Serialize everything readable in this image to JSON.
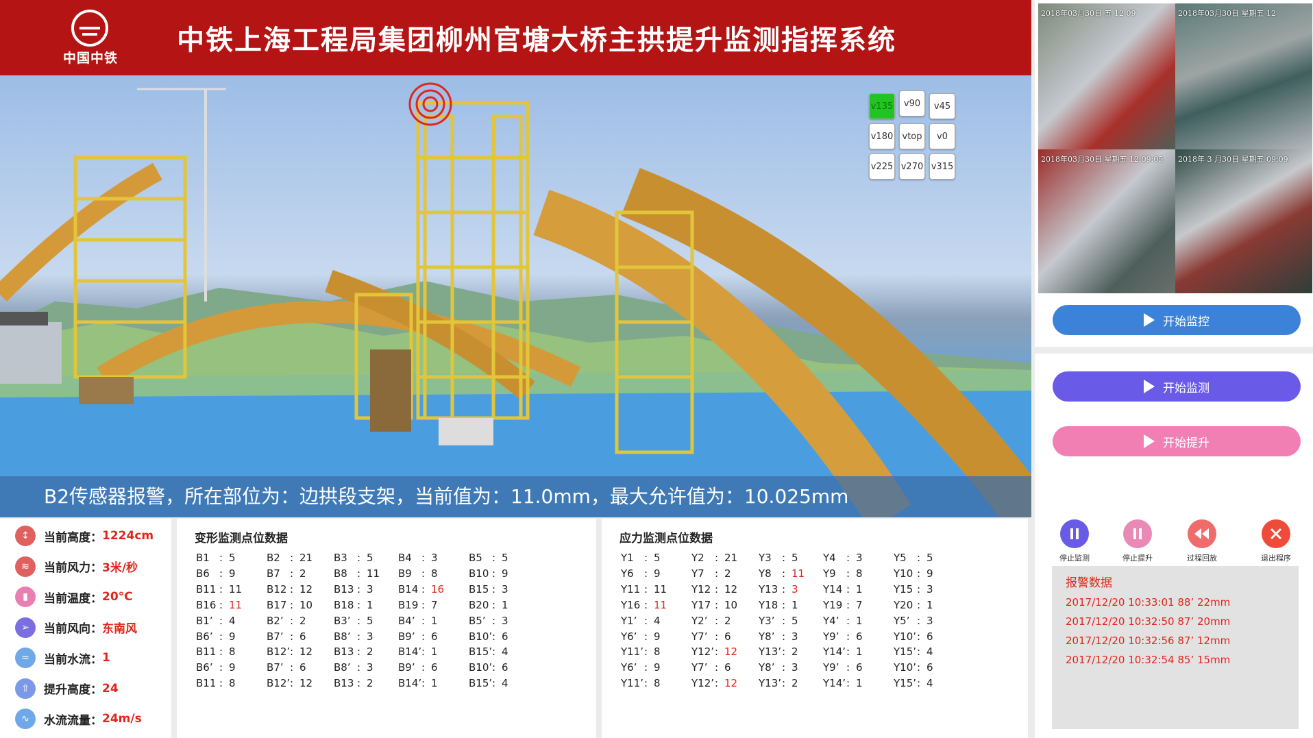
{
  "header": {
    "logo_text": "中国中铁",
    "title": "中铁上海工程局集团柳州官塘大桥主拱提升监测指挥系统"
  },
  "colors": {
    "header_red": "#b41414",
    "alert_red": "#e1251b",
    "active_green": "#22c422",
    "blue_btn": "#3b82d8",
    "purple_btn": "#6a5ae8",
    "pink_btn": "#f27fb4"
  },
  "view_buttons": [
    "v135",
    "v90",
    "v45",
    "v180",
    "vtop",
    "v0",
    "v225",
    "v270",
    "v315"
  ],
  "active_view": "v135",
  "alarm_message": "B2传感器报警，所在部位为：边拱段支架，当前值为：11.0mm，最大允许值为：10.025mm",
  "cameras": [
    {
      "timestamp": "2018年03月30日  五  12 09"
    },
    {
      "timestamp": "2018年03月30日  星期五 12"
    },
    {
      "timestamp": "2018年03月30日 星期五 12:09:05"
    },
    {
      "timestamp": "2018年 3 月30日 星期五 09:09"
    }
  ],
  "buttons": {
    "start_control": "开始监控",
    "start_monitor": "开始监测",
    "start_lift": "开始提升"
  },
  "controls": [
    {
      "label": "停止监测",
      "icon": "pause-icon"
    },
    {
      "label": "停止提升",
      "icon": "pause-icon"
    },
    {
      "label": "过程回放",
      "icon": "rewind-icon"
    },
    {
      "label": "退出程序",
      "icon": "close-icon"
    }
  ],
  "alarm_data": {
    "title": "报警数据",
    "rows": [
      "2017/12/20  10:33:01 88’   22mm",
      "2017/12/20  10:32:50 87’   20mm",
      "2017/12/20  10:32:56 87’   12mm",
      "2017/12/20  10:32:54 85’   15mm"
    ]
  },
  "status": [
    {
      "label": "当前高度：",
      "value": "1224cm",
      "icon": "height-icon",
      "color": "#e06060"
    },
    {
      "label": "当前风力：",
      "value": "3米/秒",
      "icon": "wind-icon",
      "color": "#e06060"
    },
    {
      "label": "当前温度：",
      "value": "20°C",
      "icon": "thermometer-icon",
      "color": "#e87fb0"
    },
    {
      "label": "当前风向：",
      "value": "东南风",
      "icon": "wind-direction-icon",
      "color": "#7a6ee0"
    },
    {
      "label": "当前水流：",
      "value": "1",
      "icon": "water-icon",
      "color": "#6fa8e8"
    },
    {
      "label": "提升高度：",
      "value": "24",
      "icon": "lift-icon",
      "color": "#7a9ae8"
    },
    {
      "label": "水流流量：",
      "value": "24m/s",
      "icon": "flow-icon",
      "color": "#6fa8e8"
    }
  ],
  "deform": {
    "title": "变形监测点位数据",
    "rows": [
      [
        [
          "B1",
          "5"
        ],
        [
          "B2",
          "21"
        ],
        [
          "B3",
          "5"
        ],
        [
          "B4",
          "3"
        ],
        [
          "B5",
          "5"
        ]
      ],
      [
        [
          "B6",
          "9"
        ],
        [
          "B7",
          "2"
        ],
        [
          "B8",
          "11"
        ],
        [
          "B9",
          "8"
        ],
        [
          "B10",
          "9"
        ]
      ],
      [
        [
          "B11",
          "11"
        ],
        [
          "B12",
          "12"
        ],
        [
          "B13",
          "3"
        ],
        [
          "B14",
          "16"
        ],
        [
          "B15",
          "3"
        ]
      ],
      [
        [
          "B16",
          "11"
        ],
        [
          "B17",
          "10"
        ],
        [
          "B18",
          "1"
        ],
        [
          "B19",
          "7"
        ],
        [
          "B20",
          "1"
        ]
      ],
      [
        [
          "B1’",
          "4"
        ],
        [
          "B2’",
          "2"
        ],
        [
          "B3’",
          "5"
        ],
        [
          "B4’",
          "1"
        ],
        [
          "B5’",
          "3"
        ]
      ],
      [
        [
          "B6’",
          "9"
        ],
        [
          "B7’",
          "6"
        ],
        [
          "B8’",
          "3"
        ],
        [
          "B9’",
          "6"
        ],
        [
          "B10’",
          "6"
        ]
      ],
      [
        [
          "B11",
          "8"
        ],
        [
          "B12’",
          "12"
        ],
        [
          "B13",
          "2"
        ],
        [
          "B14’",
          "1"
        ],
        [
          "B15’",
          "4"
        ]
      ],
      [
        [
          "B6’",
          "9"
        ],
        [
          "B7’",
          "6"
        ],
        [
          "B8’",
          "3"
        ],
        [
          "B9’",
          "6"
        ],
        [
          "B10’",
          "6"
        ]
      ],
      [
        [
          "B11",
          "8"
        ],
        [
          "B12’",
          "12"
        ],
        [
          "B13",
          "2"
        ],
        [
          "B14’",
          "1"
        ],
        [
          "B15’",
          "4"
        ]
      ]
    ],
    "red": [
      "B14",
      "B16"
    ]
  },
  "stress": {
    "title": "应力监测点位数据",
    "rows": [
      [
        [
          "Y1",
          "5"
        ],
        [
          "Y2",
          "21"
        ],
        [
          "Y3",
          "5"
        ],
        [
          "Y4",
          "3"
        ],
        [
          "Y5",
          "5"
        ]
      ],
      [
        [
          "Y6",
          "9"
        ],
        [
          "Y7",
          "2"
        ],
        [
          "Y8",
          "11"
        ],
        [
          "Y9",
          "8"
        ],
        [
          "Y10",
          "9"
        ]
      ],
      [
        [
          "Y11",
          "11"
        ],
        [
          "Y12",
          "12"
        ],
        [
          "Y13",
          "3"
        ],
        [
          "Y14",
          "1"
        ],
        [
          "Y15",
          "3"
        ]
      ],
      [
        [
          "Y16",
          "11"
        ],
        [
          "Y17",
          "10"
        ],
        [
          "Y18",
          "1"
        ],
        [
          "Y19",
          "7"
        ],
        [
          "Y20",
          "1"
        ]
      ],
      [
        [
          "Y1’",
          "4"
        ],
        [
          "Y2’",
          "2"
        ],
        [
          "Y3’",
          "5"
        ],
        [
          "Y4’",
          "1"
        ],
        [
          "Y5’",
          "3"
        ]
      ],
      [
        [
          "Y6’",
          "9"
        ],
        [
          "Y7’",
          "6"
        ],
        [
          "Y8’",
          "3"
        ],
        [
          "Y9’",
          "6"
        ],
        [
          "Y10’",
          "6"
        ]
      ],
      [
        [
          "Y11’",
          "8"
        ],
        [
          "Y12’",
          "12"
        ],
        [
          "Y13’",
          "2"
        ],
        [
          "Y14’",
          "1"
        ],
        [
          "Y15’",
          "4"
        ]
      ],
      [
        [
          "Y6’",
          "9"
        ],
        [
          "Y7’",
          "6"
        ],
        [
          "Y8’",
          "3"
        ],
        [
          "Y9’",
          "6"
        ],
        [
          "Y10’",
          "6"
        ]
      ],
      [
        [
          "Y11’",
          "8"
        ],
        [
          "Y12’",
          "12"
        ],
        [
          "Y13’",
          "2"
        ],
        [
          "Y14’",
          "1"
        ],
        [
          "Y15’",
          "4"
        ]
      ]
    ],
    "red": [
      "Y8",
      "Y13",
      "Y16",
      "Y12’"
    ]
  }
}
